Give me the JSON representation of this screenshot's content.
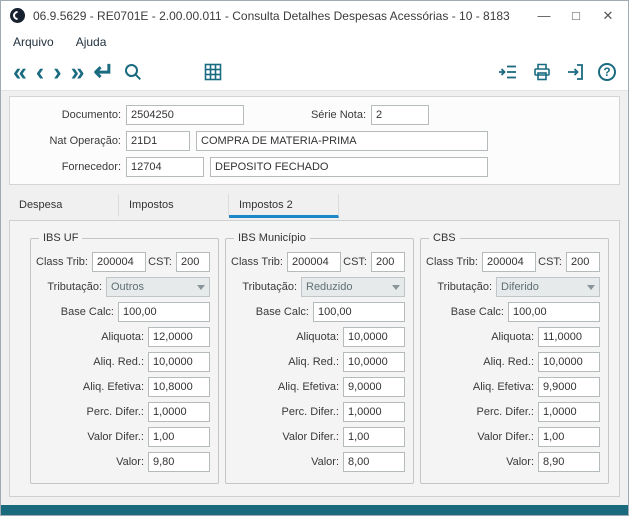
{
  "window": {
    "title": "06.9.5629 - RE0701E - 2.00.00.011 - Consulta Detalhes Despesas Acessórias - 10 - 8183",
    "minimize_glyph": "—",
    "maximize_glyph": "□",
    "close_glyph": "✕"
  },
  "menu": {
    "items": [
      {
        "label": "Arquivo"
      },
      {
        "label": "Ajuda"
      }
    ]
  },
  "toolbar": {
    "nav": [
      {
        "name": "first-record",
        "glyph": "«"
      },
      {
        "name": "previous-record",
        "glyph": "‹"
      },
      {
        "name": "next-record",
        "glyph": "›"
      },
      {
        "name": "last-record",
        "glyph": "»"
      },
      {
        "name": "return",
        "glyph": "↵"
      }
    ],
    "right_icons": [
      "export-icon",
      "print-icon",
      "exit-icon",
      "help-icon"
    ],
    "other_icons": [
      "search-icon",
      "grid-view-icon"
    ],
    "help_glyph": "?"
  },
  "header": {
    "documento": {
      "label": "Documento:",
      "value": "2504250"
    },
    "serie": {
      "label": "Série Nota:",
      "value": "2"
    },
    "nat_operacao": {
      "label": "Nat Operação:",
      "code": "21D1",
      "desc": "COMPRA DE MATERIA-PRIMA"
    },
    "fornecedor": {
      "label": "Fornecedor:",
      "code": "12704",
      "desc": "DEPOSITO FECHADO"
    }
  },
  "tabs": [
    {
      "label": "Despesa",
      "active": false
    },
    {
      "label": "Impostos",
      "active": false
    },
    {
      "label": "Impostos 2",
      "active": true
    }
  ],
  "field_labels": {
    "class_trib": "Class Trib:",
    "cst": "CST:",
    "tributacao": "Tributação:",
    "base_calc": "Base Calc:",
    "aliquota": "Aliquota:",
    "aliq_red": "Aliq. Red.:",
    "aliq_efetiva": "Aliq. Efetiva:",
    "perc_difer": "Perc. Difer.:",
    "valor_difer": "Valor Difer.:",
    "valor": "Valor:"
  },
  "groups": [
    {
      "title": "IBS UF",
      "class_trib": "200004",
      "cst": "200",
      "tributacao": "Outros",
      "base_calc": "100,00",
      "aliquota": "12,0000",
      "aliq_red": "10,0000",
      "aliq_efetiva": "10,8000",
      "perc_difer": "1,0000",
      "valor_difer": "1,00",
      "valor": "9,80"
    },
    {
      "title": "IBS Município",
      "class_trib": "200004",
      "cst": "200",
      "tributacao": "Reduzido",
      "base_calc": "100,00",
      "aliquota": "10,0000",
      "aliq_red": "10,0000",
      "aliq_efetiva": "9,0000",
      "perc_difer": "1,0000",
      "valor_difer": "1,00",
      "valor": "8,00"
    },
    {
      "title": "CBS",
      "class_trib": "200004",
      "cst": "200",
      "tributacao": "Diferido",
      "base_calc": "100,00",
      "aliquota": "11,0000",
      "aliq_red": "10,0000",
      "aliq_efetiva": "9,9000",
      "perc_difer": "1,0000",
      "valor_difer": "1,00",
      "valor": "8,90"
    }
  ],
  "colors": {
    "accent_teal": "#1a6b80",
    "tab_active_blue": "#1e87c8",
    "statusbar_teal": "#1a6a7e"
  }
}
